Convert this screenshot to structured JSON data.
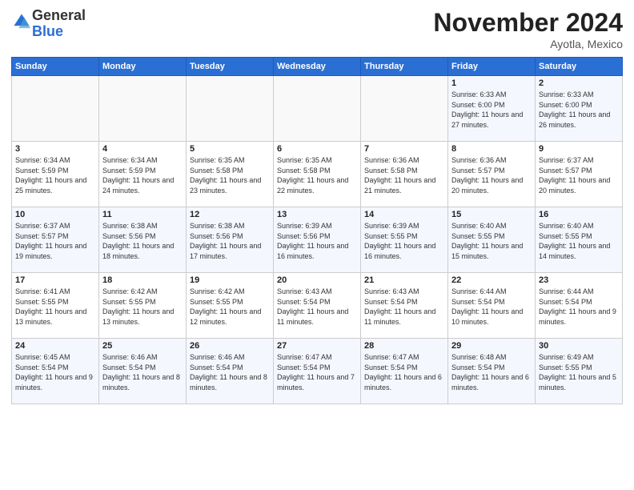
{
  "logo": {
    "general": "General",
    "blue": "Blue"
  },
  "header": {
    "month": "November 2024",
    "location": "Ayotla, Mexico"
  },
  "weekdays": [
    "Sunday",
    "Monday",
    "Tuesday",
    "Wednesday",
    "Thursday",
    "Friday",
    "Saturday"
  ],
  "weeks": [
    [
      {
        "day": "",
        "info": ""
      },
      {
        "day": "",
        "info": ""
      },
      {
        "day": "",
        "info": ""
      },
      {
        "day": "",
        "info": ""
      },
      {
        "day": "",
        "info": ""
      },
      {
        "day": "1",
        "info": "Sunrise: 6:33 AM\nSunset: 6:00 PM\nDaylight: 11 hours and 27 minutes."
      },
      {
        "day": "2",
        "info": "Sunrise: 6:33 AM\nSunset: 6:00 PM\nDaylight: 11 hours and 26 minutes."
      }
    ],
    [
      {
        "day": "3",
        "info": "Sunrise: 6:34 AM\nSunset: 5:59 PM\nDaylight: 11 hours and 25 minutes."
      },
      {
        "day": "4",
        "info": "Sunrise: 6:34 AM\nSunset: 5:59 PM\nDaylight: 11 hours and 24 minutes."
      },
      {
        "day": "5",
        "info": "Sunrise: 6:35 AM\nSunset: 5:58 PM\nDaylight: 11 hours and 23 minutes."
      },
      {
        "day": "6",
        "info": "Sunrise: 6:35 AM\nSunset: 5:58 PM\nDaylight: 11 hours and 22 minutes."
      },
      {
        "day": "7",
        "info": "Sunrise: 6:36 AM\nSunset: 5:58 PM\nDaylight: 11 hours and 21 minutes."
      },
      {
        "day": "8",
        "info": "Sunrise: 6:36 AM\nSunset: 5:57 PM\nDaylight: 11 hours and 20 minutes."
      },
      {
        "day": "9",
        "info": "Sunrise: 6:37 AM\nSunset: 5:57 PM\nDaylight: 11 hours and 20 minutes."
      }
    ],
    [
      {
        "day": "10",
        "info": "Sunrise: 6:37 AM\nSunset: 5:57 PM\nDaylight: 11 hours and 19 minutes."
      },
      {
        "day": "11",
        "info": "Sunrise: 6:38 AM\nSunset: 5:56 PM\nDaylight: 11 hours and 18 minutes."
      },
      {
        "day": "12",
        "info": "Sunrise: 6:38 AM\nSunset: 5:56 PM\nDaylight: 11 hours and 17 minutes."
      },
      {
        "day": "13",
        "info": "Sunrise: 6:39 AM\nSunset: 5:56 PM\nDaylight: 11 hours and 16 minutes."
      },
      {
        "day": "14",
        "info": "Sunrise: 6:39 AM\nSunset: 5:55 PM\nDaylight: 11 hours and 16 minutes."
      },
      {
        "day": "15",
        "info": "Sunrise: 6:40 AM\nSunset: 5:55 PM\nDaylight: 11 hours and 15 minutes."
      },
      {
        "day": "16",
        "info": "Sunrise: 6:40 AM\nSunset: 5:55 PM\nDaylight: 11 hours and 14 minutes."
      }
    ],
    [
      {
        "day": "17",
        "info": "Sunrise: 6:41 AM\nSunset: 5:55 PM\nDaylight: 11 hours and 13 minutes."
      },
      {
        "day": "18",
        "info": "Sunrise: 6:42 AM\nSunset: 5:55 PM\nDaylight: 11 hours and 13 minutes."
      },
      {
        "day": "19",
        "info": "Sunrise: 6:42 AM\nSunset: 5:55 PM\nDaylight: 11 hours and 12 minutes."
      },
      {
        "day": "20",
        "info": "Sunrise: 6:43 AM\nSunset: 5:54 PM\nDaylight: 11 hours and 11 minutes."
      },
      {
        "day": "21",
        "info": "Sunrise: 6:43 AM\nSunset: 5:54 PM\nDaylight: 11 hours and 11 minutes."
      },
      {
        "day": "22",
        "info": "Sunrise: 6:44 AM\nSunset: 5:54 PM\nDaylight: 11 hours and 10 minutes."
      },
      {
        "day": "23",
        "info": "Sunrise: 6:44 AM\nSunset: 5:54 PM\nDaylight: 11 hours and 9 minutes."
      }
    ],
    [
      {
        "day": "24",
        "info": "Sunrise: 6:45 AM\nSunset: 5:54 PM\nDaylight: 11 hours and 9 minutes."
      },
      {
        "day": "25",
        "info": "Sunrise: 6:46 AM\nSunset: 5:54 PM\nDaylight: 11 hours and 8 minutes."
      },
      {
        "day": "26",
        "info": "Sunrise: 6:46 AM\nSunset: 5:54 PM\nDaylight: 11 hours and 8 minutes."
      },
      {
        "day": "27",
        "info": "Sunrise: 6:47 AM\nSunset: 5:54 PM\nDaylight: 11 hours and 7 minutes."
      },
      {
        "day": "28",
        "info": "Sunrise: 6:47 AM\nSunset: 5:54 PM\nDaylight: 11 hours and 6 minutes."
      },
      {
        "day": "29",
        "info": "Sunrise: 6:48 AM\nSunset: 5:54 PM\nDaylight: 11 hours and 6 minutes."
      },
      {
        "day": "30",
        "info": "Sunrise: 6:49 AM\nSunset: 5:55 PM\nDaylight: 11 hours and 5 minutes."
      }
    ]
  ]
}
